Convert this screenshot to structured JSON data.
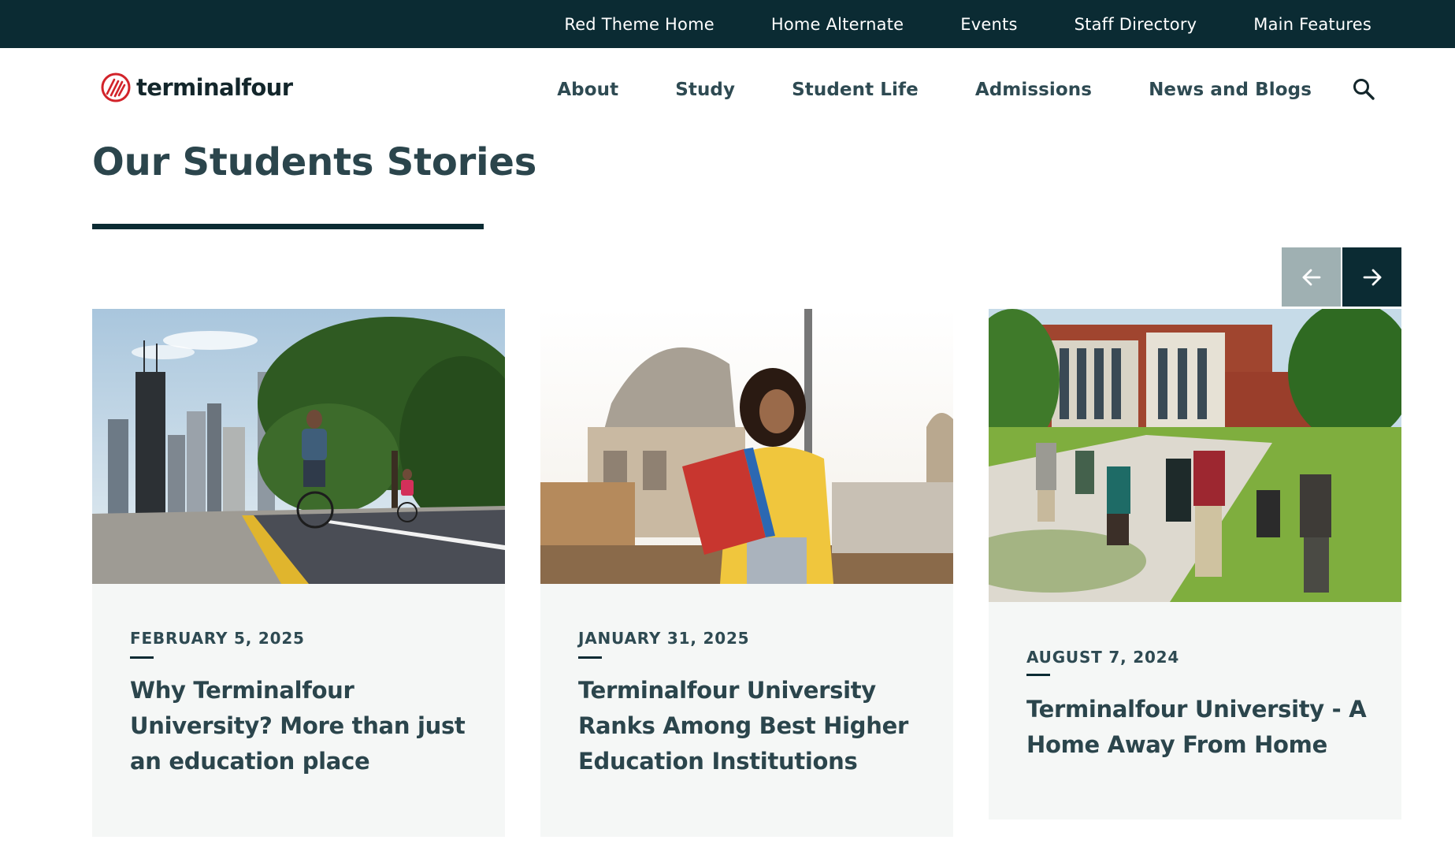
{
  "utility_nav": {
    "items": [
      {
        "label": "Red Theme Home"
      },
      {
        "label": "Home Alternate"
      },
      {
        "label": "Events"
      },
      {
        "label": "Staff Directory"
      },
      {
        "label": "Main Features"
      }
    ]
  },
  "header": {
    "logo_text": "terminalfour",
    "nav": [
      {
        "label": "About"
      },
      {
        "label": "Study"
      },
      {
        "label": "Student Life"
      },
      {
        "label": "Admissions"
      },
      {
        "label": "News and Blogs"
      }
    ],
    "search_icon": "search-icon"
  },
  "section": {
    "title": "Our Students Stories"
  },
  "carousel": {
    "prev_icon": "arrow-left-icon",
    "next_icon": "arrow-right-icon"
  },
  "cards": [
    {
      "date": "FEBRUARY 5, 2025",
      "title": "Why Terminalfour University? More than just an education place"
    },
    {
      "date": "JANUARY 31, 2025",
      "title": "Terminalfour University Ranks Among Best Higher Education Institutions"
    },
    {
      "date": "AUGUST 7, 2024",
      "title": "Terminalfour University - A Home Away From Home"
    }
  ],
  "colors": {
    "dark_navy": "#0b2b33",
    "heading_text": "#2b454c",
    "brand_red": "#d2232a",
    "card_bg": "#f5f7f6",
    "prev_button_bg": "#9fb0b2"
  }
}
